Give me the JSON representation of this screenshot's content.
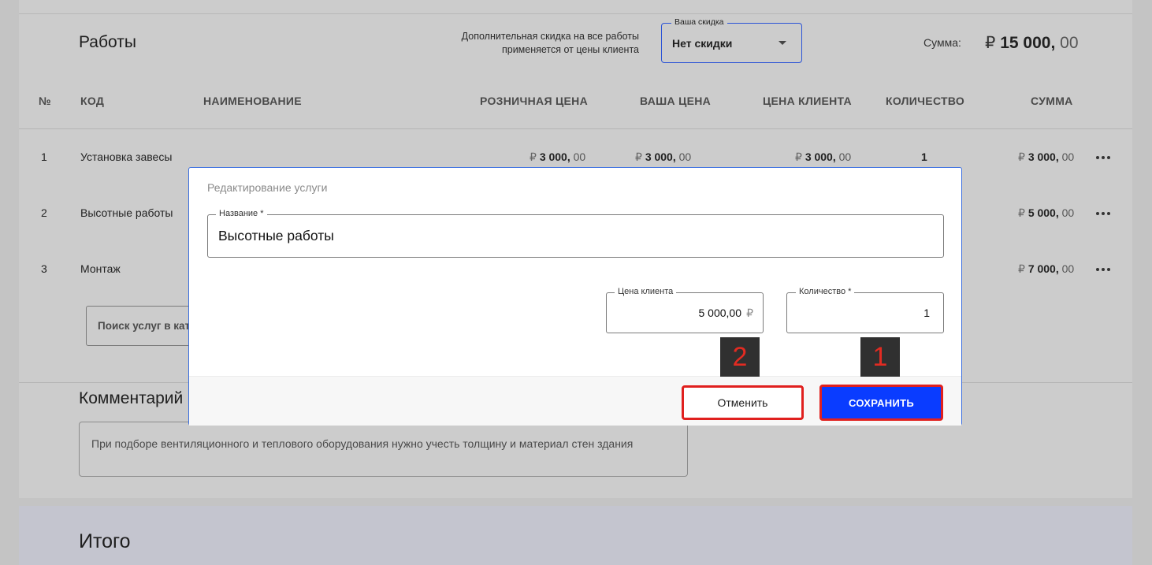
{
  "works": {
    "title": "Работы",
    "discount_note_line1": "Дополнительная скидка на все работы",
    "discount_note_line2": "применяется от цены клиента",
    "discount_legend": "Ваша скидка",
    "discount_value": "Нет скидки",
    "sum_label": "Сумма:",
    "sum_currency": "₽",
    "sum_int": "15 000,",
    "sum_dec": "00"
  },
  "table": {
    "headers": {
      "num": "№",
      "code": "КОД",
      "name": "НАИМЕНОВАНИЕ",
      "retail": "РОЗНИЧНАЯ ЦЕНА",
      "your": "ВАША ЦЕНА",
      "client": "ЦЕНА КЛИЕНТА",
      "qty": "КОЛИЧЕСТВО",
      "sum": "СУММА"
    },
    "rows": [
      {
        "num": "1",
        "name": "Установка завесы",
        "retail": "3 000,",
        "your": "3 000,",
        "client": "3 000,",
        "qty": "1",
        "sum": "3 000,",
        "dec": "00",
        "rub": "₽"
      },
      {
        "num": "2",
        "name": "Высотные работы",
        "sum": "5 000,",
        "dec": "00",
        "rub": "₽"
      },
      {
        "num": "3",
        "name": "Монтаж",
        "sum": "7 000,",
        "dec": "00",
        "rub": "₽"
      }
    ],
    "search_placeholder": "Поиск услуг в кат"
  },
  "comment": {
    "title": "Комментарий",
    "text": "При подборе вентиляционного и теплового оборудования нужно учесть толщину и материал стен здания"
  },
  "total": {
    "title": "Итого"
  },
  "modal": {
    "title": "Редактирование услуги",
    "name_legend": "Название *",
    "name_value": "Высотные работы",
    "price_legend": "Цена клиента",
    "price_value": "5 000,00",
    "price_unit": "₽",
    "qty_legend": "Количество *",
    "qty_value": "1",
    "cancel_label": "Отменить",
    "save_label": "СОХРАНИТЬ"
  },
  "annotations": {
    "badge_1": "1",
    "badge_2": "2",
    "highlight_color": "#e0201e"
  }
}
